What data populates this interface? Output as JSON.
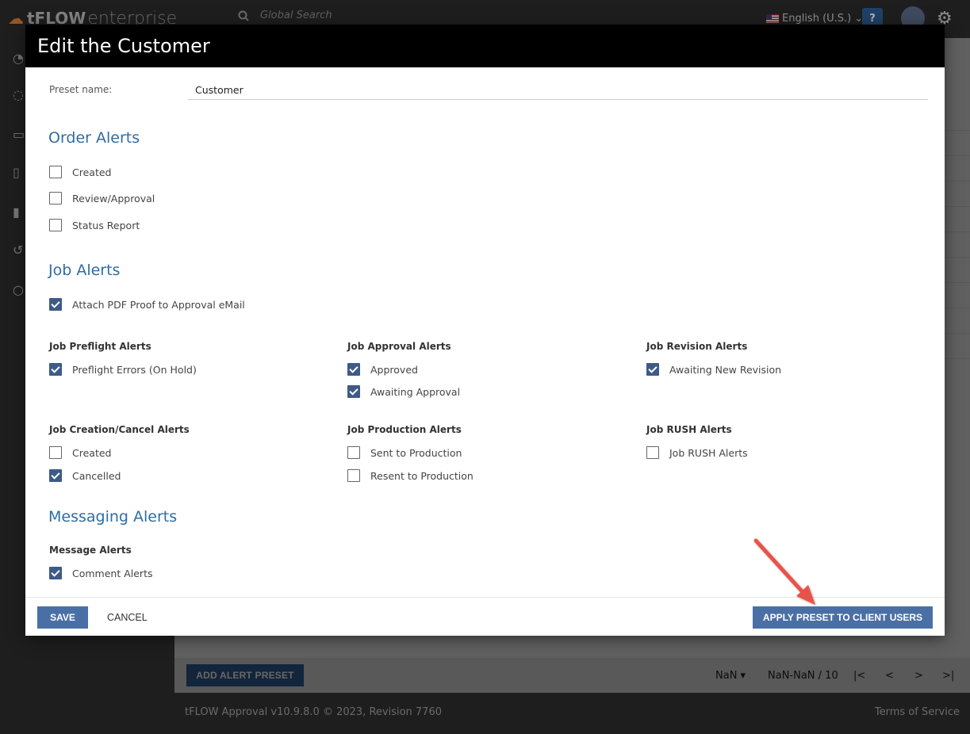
{
  "app": {
    "brand": "tFLOW",
    "brand_suffix": "enterprise",
    "search_placeholder": "Global Search",
    "language": "English (U.S.)",
    "help_label": "?"
  },
  "background": {
    "add_preset_label": "ADD ALERT PRESET",
    "page_size": "NaN",
    "range": "NaN-NaN / 10",
    "footer_version": "tFLOW Approval v10.9.8.0 © 2023, Revision 7760",
    "footer_tos": "Terms of Service"
  },
  "modal": {
    "title": "Edit the Customer",
    "preset_label": "Preset name:",
    "preset_value": "Customer",
    "order_alerts": {
      "title": "Order Alerts",
      "items": [
        {
          "label": "Created",
          "checked": false
        },
        {
          "label": "Review/Approval",
          "checked": false
        },
        {
          "label": "Status Report",
          "checked": false
        }
      ]
    },
    "job_alerts": {
      "title": "Job Alerts",
      "attach_pdf": {
        "label": "Attach PDF Proof to Approval eMail",
        "checked": true
      },
      "preflight": {
        "title": "Job Preflight Alerts",
        "items": [
          {
            "label": "Preflight Errors (On Hold)",
            "checked": true
          }
        ]
      },
      "approval": {
        "title": "Job Approval Alerts",
        "items": [
          {
            "label": "Approved",
            "checked": true
          },
          {
            "label": "Awaiting Approval",
            "checked": true
          }
        ]
      },
      "revision": {
        "title": "Job Revision Alerts",
        "items": [
          {
            "label": "Awaiting New Revision",
            "checked": true
          }
        ]
      },
      "creation_cancel": {
        "title": "Job Creation/Cancel Alerts",
        "items": [
          {
            "label": "Created",
            "checked": false
          },
          {
            "label": "Cancelled",
            "checked": true
          }
        ]
      },
      "production": {
        "title": "Job Production Alerts",
        "items": [
          {
            "label": "Sent to Production",
            "checked": false
          },
          {
            "label": "Resent to Production",
            "checked": false
          }
        ]
      },
      "rush": {
        "title": "Job RUSH Alerts",
        "items": [
          {
            "label": "Job RUSH Alerts",
            "checked": false
          }
        ]
      }
    },
    "messaging_alerts": {
      "title": "Messaging Alerts",
      "message": {
        "title": "Message Alerts",
        "items": [
          {
            "label": "Comment Alerts",
            "checked": true
          }
        ]
      }
    },
    "footer": {
      "save_label": "SAVE",
      "cancel_label": "CANCEL",
      "apply_label": "APPLY PRESET TO CLIENT USERS"
    }
  },
  "colors": {
    "accent": "#4a6fa5",
    "section_title": "#2e6da4",
    "annotation_arrow": "#e8534a"
  }
}
